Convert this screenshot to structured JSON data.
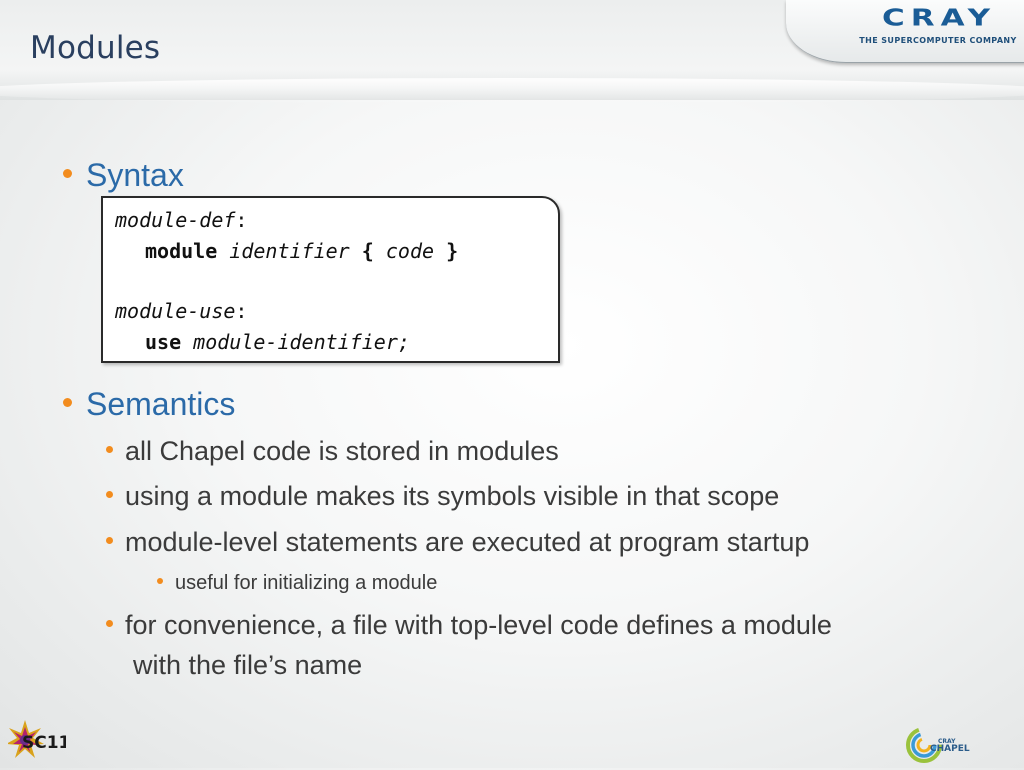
{
  "slide": {
    "title": "Modules"
  },
  "logos": {
    "cray_word": "CRAY",
    "cray_tagline": "THE SUPERCOMPUTER COMPANY",
    "sc11_text": "SC11",
    "chapel_top": "CRAY",
    "chapel_bottom": "CHAPEL"
  },
  "colors": {
    "title": "#2a3f5f",
    "level1_text": "#2b6aa8",
    "bullet": "#f28c1e",
    "cray_blue": "#1a5c96"
  },
  "syntax": {
    "heading": "Syntax",
    "def_label": "module-def",
    "def_colon": ":",
    "kw_module": "module",
    "identifier": "identifier",
    "open_brace": "{",
    "code": "code",
    "close_brace": "}",
    "use_label": "module-use",
    "use_colon": ":",
    "kw_use": "use",
    "module_identifier": "module-identifier;"
  },
  "semantics": {
    "heading": "Semantics",
    "item1": "all Chapel code is stored in modules",
    "item2": "using a module makes its symbols visible in that scope",
    "item3": "module-level statements are executed at program startup",
    "item3_sub": "useful for initializing a module",
    "item4_line1": "for convenience, a file with top-level code defines a module",
    "item4_line2": "with the file’s name"
  }
}
